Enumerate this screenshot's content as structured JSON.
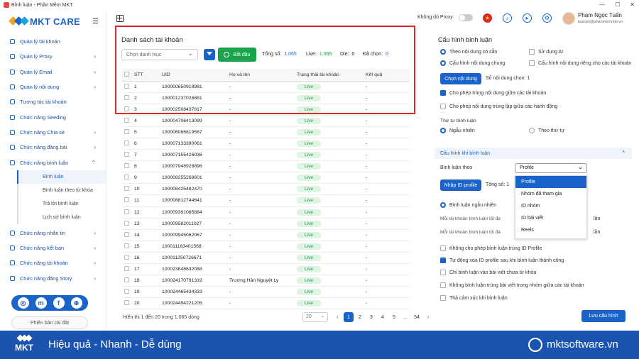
{
  "window": {
    "title": "Bình luận - Phần Mềm MKT",
    "controls": [
      "—",
      "☐",
      "✕"
    ]
  },
  "brand": {
    "logo_text": "MKT CARE"
  },
  "sidebar": {
    "items": [
      {
        "label": "Quản lý tài khoản",
        "chevron": ""
      },
      {
        "label": "Quản lý Proxy",
        "chevron": "›"
      },
      {
        "label": "Quản lý Email",
        "chevron": "›"
      },
      {
        "label": "Quản lý nội dung",
        "chevron": "›"
      },
      {
        "label": "Tương tác tài khoản",
        "chevron": ""
      },
      {
        "label": "Chức năng Seeding",
        "chevron": ""
      },
      {
        "label": "Chức năng Chia sẻ",
        "chevron": "›"
      },
      {
        "label": "Chức năng đăng bài",
        "chevron": "›"
      },
      {
        "label": "Chức năng bình luận",
        "chevron": "⌃"
      }
    ],
    "subitems": [
      "Bình luận",
      "Bình luận theo từ khóa",
      "Trả lời bình luận",
      "Lịch sử bình luận"
    ],
    "items2": [
      {
        "label": "Chức năng nhắn tin",
        "chevron": "›"
      },
      {
        "label": "Chức năng kết bạn",
        "chevron": "›"
      },
      {
        "label": "Chức năng tài khoản",
        "chevron": "›"
      },
      {
        "label": "Chức năng đăng Story",
        "chevron": "›"
      }
    ],
    "social": [
      "◎",
      "m",
      "f",
      "⊕"
    ],
    "version": "Phiên bản cài đặt"
  },
  "topbar": {
    "proxy_label": "Không dò Proxy",
    "user_name": "Phạm Ngọc Tuấn",
    "user_email": "tuanpn@phanmemmkt.vn"
  },
  "main": {
    "title": "Danh sách tài khoản",
    "category_placeholder": "Chọn danh mục",
    "start_button": "Bắt đầu",
    "stats": {
      "total_label": "Tổng số:",
      "total": "1.065",
      "live_label": "Live:",
      "live": "1.065",
      "die_label": "Die:",
      "die": "0",
      "selected_label": "Đã chọn:",
      "selected": "0"
    },
    "columns": [
      "STT",
      "UID",
      "Họ và tên",
      "Trạng thái tài khoản",
      "Kết quả"
    ],
    "rows": [
      [
        "1",
        "100000650918981",
        "-",
        "Live",
        "-"
      ],
      [
        "2",
        "100001237026881",
        "-",
        "Live",
        "-"
      ],
      [
        "3",
        "100002508437617",
        "-",
        "Live",
        "-"
      ],
      [
        "4",
        "100004706413099",
        "-",
        "Live",
        "-"
      ],
      [
        "5",
        "100006086819567",
        "-",
        "Live",
        "-"
      ],
      [
        "6",
        "100007133390061",
        "-",
        "Live",
        "-"
      ],
      [
        "7",
        "100007155426036",
        "-",
        "Live",
        "-"
      ],
      [
        "8",
        "100007948928896",
        "-",
        "Live",
        "-"
      ],
      [
        "9",
        "100008255268601",
        "-",
        "Live",
        "-"
      ],
      [
        "10",
        "100008425482470",
        "-",
        "Live",
        "-"
      ],
      [
        "11",
        "100008812744641",
        "-",
        "Live",
        "-"
      ],
      [
        "12",
        "100009391065884",
        "-",
        "Live",
        "-"
      ],
      [
        "13",
        "100009582011027",
        "-",
        "Live",
        "-"
      ],
      [
        "14",
        "100009945062067",
        "-",
        "Live",
        "-"
      ],
      [
        "15",
        "100011163401568",
        "-",
        "Live",
        "-"
      ],
      [
        "16",
        "100011250726671",
        "-",
        "Live",
        "-"
      ],
      [
        "17",
        "100023848632088",
        "-",
        "Live",
        "-"
      ],
      [
        "18",
        "100024170791319",
        "Trương Hân Nguyệt Ly",
        "Live",
        "-"
      ],
      [
        "19",
        "100024465434333",
        "-",
        "Live",
        "-"
      ],
      [
        "20",
        "100024494221205",
        "-",
        "Live",
        "-"
      ]
    ],
    "footer": "Hiển thị 1 đến 20 trong 1.065 dòng",
    "page_size": "20",
    "pages": [
      "‹",
      "1",
      "2",
      "3",
      "4",
      "5",
      "...",
      "54",
      "›"
    ]
  },
  "config": {
    "title": "Cấu hình bình luận",
    "opt1": "Theo nội dung có sẵn",
    "opt2": "Sử dụng AI",
    "opt3": "Cấu hình nội dung chung",
    "opt4": "Cấu hình nội dung riêng cho các tài khoản",
    "select_content": "Chọn nội dung",
    "selected_count": "Số nội dung chọn: 1",
    "chk1": "Cho phép trùng nội dung giữa các tài khoản",
    "chk2": "Cho phép nội dung trùng lặp giữa các hành động",
    "order_label": "Thứ tự bình luận",
    "order_random": "Ngẫu nhiên",
    "order_seq": "Theo thứ tự",
    "section": "Cấu hình khi bình luận",
    "comment_by": "Bình luận theo",
    "comment_by_value": "Profile",
    "import_btn": "Nhập ID profile",
    "total": "Tổng số: 1",
    "random_comment": "Bình luận ngẫu nhiên",
    "max1": "Mỗi tài khoản bình luận tối đa",
    "max2": "Mỗi tài khoản bình luận tối đa",
    "times": "lần",
    "dropdown": [
      "Profile",
      "Nhóm đã tham gia",
      "ID nhóm",
      "ID bài viết",
      "Reels"
    ],
    "c1": "Không cho phép bình luận trùng ID Profile",
    "c2": "Tự động xóa ID profile sau khi bình luận thành công",
    "c3": "Chỉ bình luận vào bài viết chưa từ khóa",
    "c4": "Không bình luận trùng bài viết trong nhóm giữa các tài khoản",
    "c5": "Thả cảm xúc khi bình luận",
    "save": "Lưu cấu hình"
  },
  "banner": {
    "logo": "MKT",
    "slogan": "Hiệu quả - Nhanh - Dễ dùng",
    "site": "mktsoftware.vn"
  },
  "colors": {
    "primary": "#1a63c9",
    "green": "#1aa34a",
    "highlight": "#d9292b",
    "banner": "#1a53b0"
  }
}
